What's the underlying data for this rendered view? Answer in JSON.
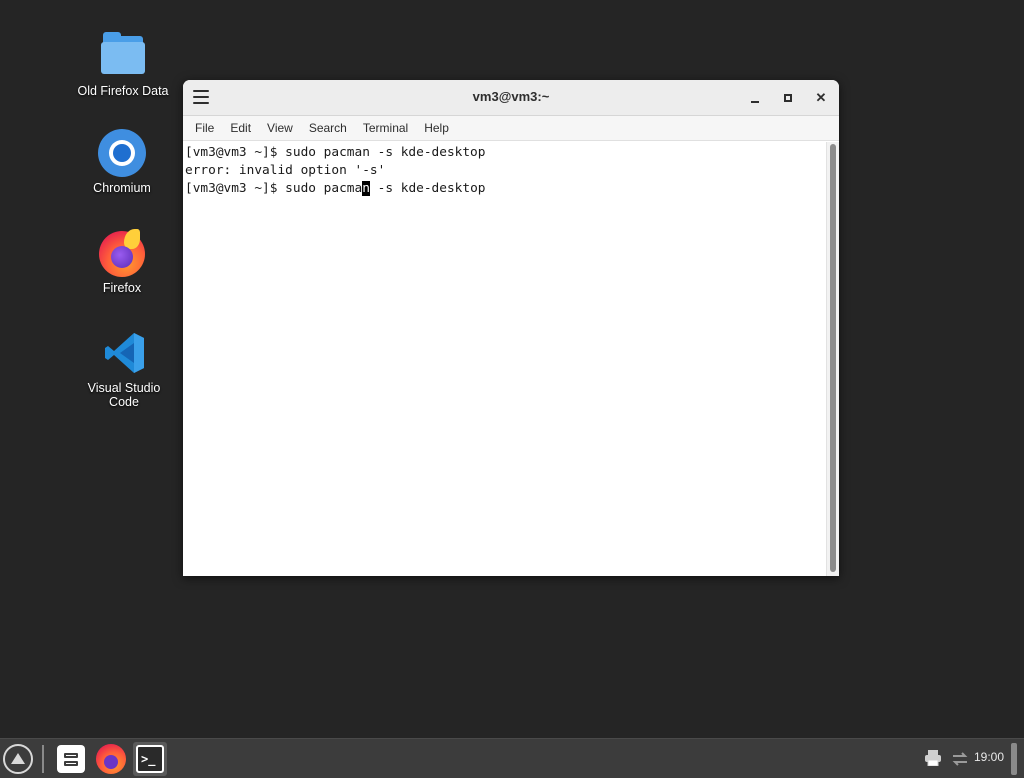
{
  "desktop": {
    "icons": [
      {
        "label": "Old Firefox Data",
        "icon": "folder-icon"
      },
      {
        "label": "Chromium",
        "icon": "chromium-icon"
      },
      {
        "label": "Firefox",
        "icon": "firefox-icon"
      },
      {
        "label": "Visual Studio\nCode",
        "icon": "vscode-icon"
      }
    ]
  },
  "window": {
    "title": "vm3@vm3:~",
    "menu": [
      "File",
      "Edit",
      "View",
      "Search",
      "Terminal",
      "Help"
    ],
    "controls": {
      "minimize": "minimize-icon",
      "maximize": "maximize-icon",
      "close": "close-icon",
      "close_glyph": "✕"
    }
  },
  "terminal": {
    "lines": [
      "[vm3@vm3 ~]$ sudo pacman -s kde-desktop",
      "error: invalid option '-s'"
    ],
    "current": {
      "before_cursor": "[vm3@vm3 ~]$ sudo pacma",
      "cursor_char": "n",
      "after_cursor": " -s kde-desktop"
    }
  },
  "taskbar": {
    "apps": [
      "app-menu-icon",
      "file-manager-icon",
      "firefox-icon",
      "terminal-icon"
    ],
    "terminal_glyph": ">_",
    "tray": [
      "printer-icon",
      "network-icon"
    ],
    "clock": "19:00"
  },
  "colors": {
    "desktop_bg": "#252525",
    "taskbar_bg": "#3c3c3c",
    "titlebar_bg": "#ededed"
  }
}
